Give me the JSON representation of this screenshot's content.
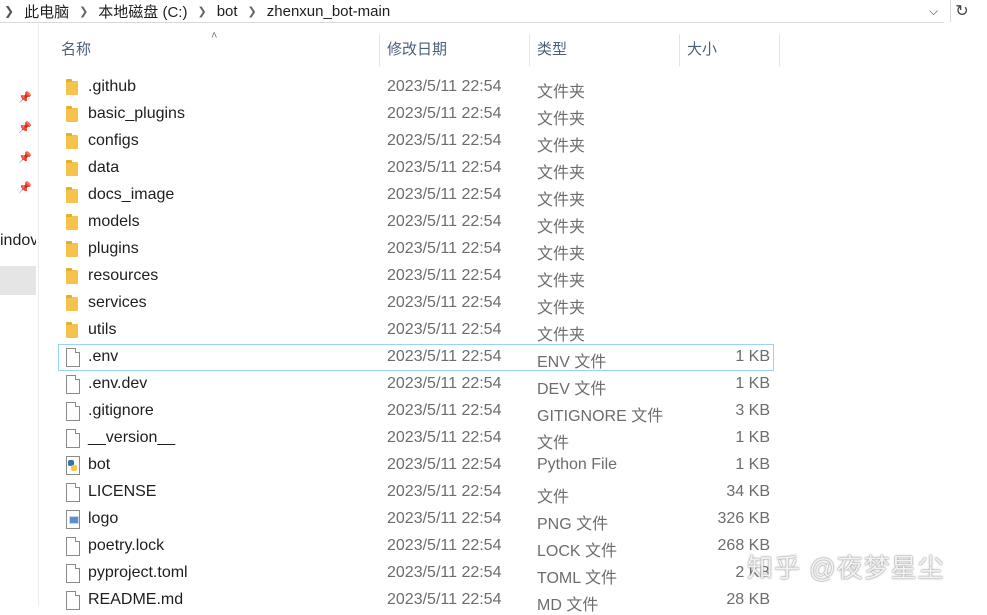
{
  "breadcrumb": [
    "此电脑",
    "本地磁盘 (C:)",
    "bot",
    "zhenxun_bot-main"
  ],
  "nav": {
    "partial_label": "indov"
  },
  "columns": {
    "name": "名称",
    "date": "修改日期",
    "type": "类型",
    "size": "大小"
  },
  "files": [
    {
      "name": ".github",
      "date": "2023/5/11 22:54",
      "type": "文件夹",
      "size": "",
      "icon": "folder-icon"
    },
    {
      "name": "basic_plugins",
      "date": "2023/5/11 22:54",
      "type": "文件夹",
      "size": "",
      "icon": "folder-icon"
    },
    {
      "name": "configs",
      "date": "2023/5/11 22:54",
      "type": "文件夹",
      "size": "",
      "icon": "folder-icon"
    },
    {
      "name": "data",
      "date": "2023/5/11 22:54",
      "type": "文件夹",
      "size": "",
      "icon": "folder-icon"
    },
    {
      "name": "docs_image",
      "date": "2023/5/11 22:54",
      "type": "文件夹",
      "size": "",
      "icon": "folder-icon"
    },
    {
      "name": "models",
      "date": "2023/5/11 22:54",
      "type": "文件夹",
      "size": "",
      "icon": "folder-icon"
    },
    {
      "name": "plugins",
      "date": "2023/5/11 22:54",
      "type": "文件夹",
      "size": "",
      "icon": "folder-icon"
    },
    {
      "name": "resources",
      "date": "2023/5/11 22:54",
      "type": "文件夹",
      "size": "",
      "icon": "folder-icon"
    },
    {
      "name": "services",
      "date": "2023/5/11 22:54",
      "type": "文件夹",
      "size": "",
      "icon": "folder-icon"
    },
    {
      "name": "utils",
      "date": "2023/5/11 22:54",
      "type": "文件夹",
      "size": "",
      "icon": "folder-icon"
    },
    {
      "name": ".env",
      "date": "2023/5/11 22:54",
      "type": "ENV 文件",
      "size": "1 KB",
      "icon": "file-icon"
    },
    {
      "name": ".env.dev",
      "date": "2023/5/11 22:54",
      "type": "DEV 文件",
      "size": "1 KB",
      "icon": "file-icon"
    },
    {
      "name": ".gitignore",
      "date": "2023/5/11 22:54",
      "type": "GITIGNORE 文件",
      "size": "3 KB",
      "icon": "file-icon"
    },
    {
      "name": "__version__",
      "date": "2023/5/11 22:54",
      "type": "文件",
      "size": "1 KB",
      "icon": "file-icon"
    },
    {
      "name": "bot",
      "date": "2023/5/11 22:54",
      "type": "Python File",
      "size": "1 KB",
      "icon": "python-file-icon"
    },
    {
      "name": "LICENSE",
      "date": "2023/5/11 22:54",
      "type": "文件",
      "size": "34 KB",
      "icon": "file-icon"
    },
    {
      "name": "logo",
      "date": "2023/5/11 22:54",
      "type": "PNG 文件",
      "size": "326 KB",
      "icon": "image-file-icon"
    },
    {
      "name": "poetry.lock",
      "date": "2023/5/11 22:54",
      "type": "LOCK 文件",
      "size": "268 KB",
      "icon": "file-icon"
    },
    {
      "name": "pyproject.toml",
      "date": "2023/5/11 22:54",
      "type": "TOML 文件",
      "size": "2 KB",
      "icon": "file-icon"
    },
    {
      "name": "README.md",
      "date": "2023/5/11 22:54",
      "type": "MD 文件",
      "size": "28 KB",
      "icon": "file-icon"
    }
  ],
  "watermark": "知乎 @夜梦星尘"
}
